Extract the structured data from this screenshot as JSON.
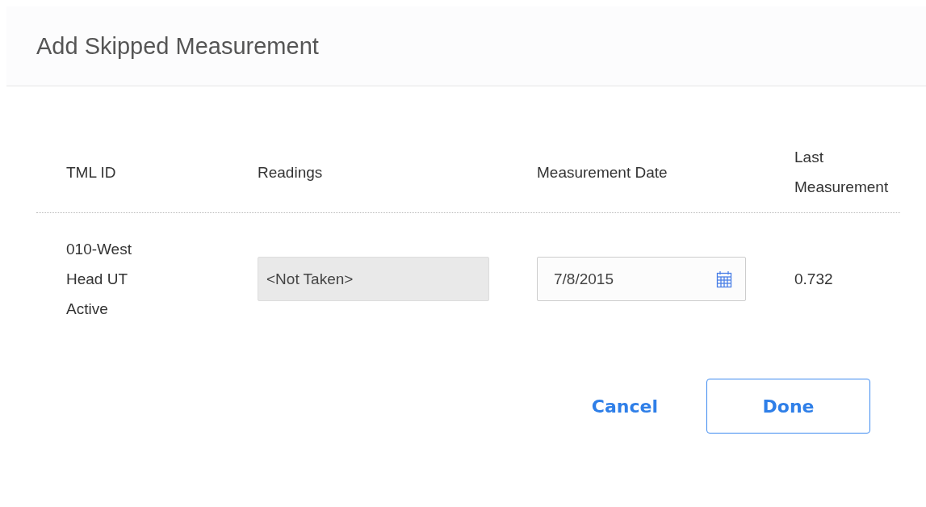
{
  "dialog": {
    "title": "Add Skipped Measurement"
  },
  "table": {
    "columns": [
      "TML ID",
      "Readings",
      "Measurement Date",
      "Last Measurement"
    ],
    "rows": [
      {
        "tml_id": "010-West Head UT Active",
        "readings": {
          "value": "<Not Taken>",
          "disabled": true
        },
        "measurement_date": {
          "value": "7/8/2015"
        },
        "last_measurement": "0.732"
      }
    ]
  },
  "buttons": [
    {
      "label": "Cancel",
      "kind": "link"
    },
    {
      "label": "Done",
      "kind": "outlined"
    }
  ]
}
